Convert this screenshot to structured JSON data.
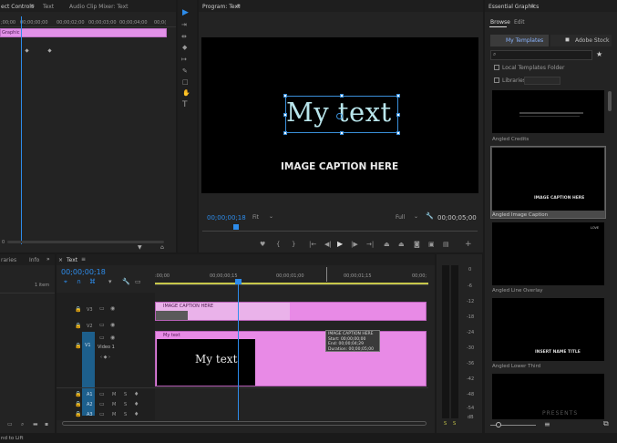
{
  "effects_panel": {
    "tabs": [
      "ect Controls",
      "Text",
      "Audio Clip Mixer: Text"
    ],
    "ruler": [
      ";00;00",
      "00;00;00;00",
      "00;00;02;00",
      "00;00;03;00",
      "00;00;04;00",
      "00;0("
    ],
    "graphic_label": "Graphic",
    "time_label": "0"
  },
  "tools": [
    "select",
    "track-select",
    "ripple",
    "razor",
    "slip",
    "pen",
    "rectangle",
    "hand",
    "type"
  ],
  "program": {
    "title": "Program: Text",
    "overlay_text": "My text",
    "caption_text": "IMAGE CAPTION HERE",
    "timecode": "00;00;00;18",
    "fit_label": "Fit",
    "quality_label": "Full",
    "duration": "00;00;05;00"
  },
  "project_panel": {
    "tabs": [
      "raries",
      "Info"
    ],
    "item_count": "1 item"
  },
  "timeline": {
    "tab": "Text",
    "timecode": "00;00;00;18",
    "ruler": [
      ":00;00",
      "00;00;00;15",
      "00;00;01;00",
      "00;00;01;15",
      "00;00;"
    ],
    "tracks": {
      "v3": "V3",
      "v2": "V2",
      "v1": "V1",
      "v1_label": "Video 1",
      "a1": "A1",
      "a2": "A2",
      "a3": "A3",
      "m": "M",
      "s": "S"
    },
    "clip_v3": "IMAGE CAPTION HERE",
    "clip_v2": "My text",
    "clip_v2_preview": "My text",
    "tooltip": {
      "title": "IMAGE CAPTION HERE",
      "start": "Start: 00;00;00;00",
      "end": "End: 00;00;04;29",
      "duration": "Duration: 00;00;05;00"
    }
  },
  "meter": {
    "scale": [
      "0",
      "-6",
      "-12",
      "-18",
      "-24",
      "-30",
      "-36",
      "-42",
      "-48",
      "-54",
      "dB"
    ],
    "footer": [
      "S",
      "S"
    ]
  },
  "essential_graphics": {
    "title": "Essential Graphics",
    "tabs": [
      "Browse",
      "Edit"
    ],
    "sources": [
      "My Templates",
      "Adobe Stock"
    ],
    "local_templates": "Local Templates Folder",
    "libraries": "Libraries",
    "templates": [
      {
        "name": "Angled Credits",
        "preview": ""
      },
      {
        "name": "Angled Image Caption",
        "preview": "IMAGE CAPTION HERE"
      },
      {
        "name": "Angled Line Overlay",
        "preview": "LOVE"
      },
      {
        "name": "Angled Lower Third",
        "preview": "INSERT NAME TITLE"
      },
      {
        "name": "",
        "preview": "PRESENTS"
      }
    ]
  },
  "status_bar": {
    "text": "nd to Lift"
  }
}
